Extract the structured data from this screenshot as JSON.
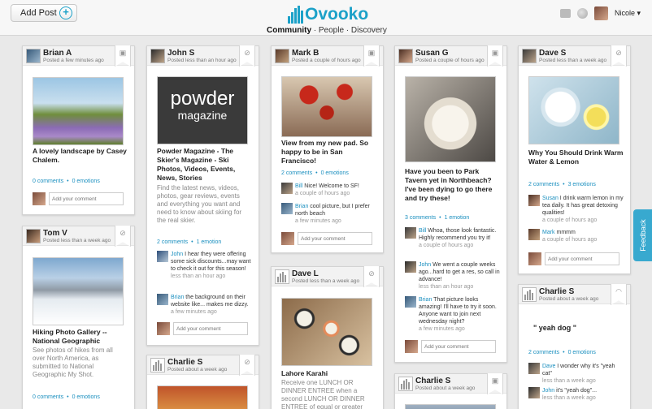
{
  "header": {
    "add_post_label": "Add Post",
    "logo_text": "Ovooko",
    "nav": {
      "active": "Community",
      "sep1": " · ",
      "people": "People",
      "sep2": " · ",
      "discovery": "Discovery"
    },
    "username": "Nicole",
    "caret": "▾"
  },
  "feedback_label": "Feedback",
  "comment_placeholder": "Add your comment",
  "posts": [
    {
      "author": "Brian A",
      "time": "Posted a few minutes ago",
      "icon": "camera-icon",
      "title": "A lovely landscape by Casey Chalem.",
      "stats": {
        "comments": "0 comments",
        "emotions": "0 emotions"
      }
    },
    {
      "author": "Tom V",
      "time": "Posted less than a week ago",
      "icon": "link-icon",
      "title": "Hiking Photo Gallery -- National Geographic",
      "desc": "See photos of hikes from all over North America, as submitted to National Geographic My Shot.",
      "stats": {
        "comments": "0 comments",
        "emotions": "0 emotions"
      }
    },
    {
      "author": "John S",
      "time": "Posted less than an hour ago",
      "icon": "link-icon",
      "image_text": {
        "line1": "powder",
        "line2": "magazine"
      },
      "title": "Powder Magazine - The Skier's Magazine - Ski Photos, Videos, Events, News, Stories",
      "desc": "Find the latest news, videos, photos, gear reviews, events and everything you want and need to know about skiing for the real skier.",
      "stats": {
        "comments": "2 comments",
        "emotions": "1 emotion"
      },
      "comments": [
        {
          "who": "John",
          "text": " I hear they were offering some sick discounts...may want to check it out for this season!",
          "when": "less than an hour ago"
        },
        {
          "who": "Brian",
          "text": " the background on their website like... makes me dizzy.",
          "when": "a few minutes ago"
        }
      ]
    },
    {
      "author": "Charlie S",
      "time": "Posted about a week ago",
      "icon": "link-icon"
    },
    {
      "author": "Mark B",
      "time": "Posted a couple of hours ago",
      "icon": "camera-icon",
      "title": "View from my new pad. So happy to be in San Francisco!",
      "stats": {
        "comments": "2 comments",
        "emotions": "0 emotions"
      },
      "comments": [
        {
          "who": "Bill",
          "text": " Nice! Welcome to SF!",
          "when": "a couple of hours ago"
        },
        {
          "who": "Brian",
          "text": " cool picture, but I prefer north beach",
          "when": "a few minutes ago"
        }
      ]
    },
    {
      "author": "Dave L",
      "time": "Posted less than a week ago",
      "icon": "link-icon",
      "title": "Lahore Karahi",
      "desc": "Receive one LUNCH OR DINNER ENTREE when a second LUNCH OR DINNER ENTREE of equal or greater"
    },
    {
      "author": "Susan G",
      "time": "Posted a couple of hours ago",
      "icon": "camera-icon",
      "title": "Have you been to Park Tavern yet in Northbeach? I've been dying to go there and try these!",
      "stats": {
        "comments": "3 comments",
        "emotions": "1 emotion"
      },
      "comments": [
        {
          "who": "Bill",
          "text": " Whoa, those look fantastic. Highly recommend you try it!",
          "when": "a couple of hours ago"
        },
        {
          "who": "John",
          "text": " We went a couple weeks ago...hard to get a res, so call in advance!",
          "when": "less than an hour ago"
        },
        {
          "who": "Brian",
          "text": " That picture looks amazing! I'll have to try it soon. Anyone want to join next wednesday night?",
          "when": "a few minutes ago"
        }
      ]
    },
    {
      "author": "Charlie S",
      "time": "Posted about a week ago",
      "icon": "camera-icon"
    },
    {
      "author": "Dave S",
      "time": "Posted less than a week ago",
      "icon": "link-icon",
      "title": "Why You Should Drink Warm Water & Lemon",
      "stats": {
        "comments": "2 comments",
        "emotions": "3 emotions"
      },
      "comments": [
        {
          "who": "Susan",
          "text": " I drink warm lemon in my tea daily. It has great detoxing qualities!",
          "when": "a couple of hours ago"
        },
        {
          "who": "Mark",
          "text": " mmmm",
          "when": "a couple of hours ago"
        }
      ]
    },
    {
      "author": "Charlie S",
      "time": "Posted about a week ago",
      "icon": "speech-icon",
      "quote": "\" yeah dog \"",
      "stats": {
        "comments": "2 comments",
        "emotions": "0 emotions"
      },
      "comments": [
        {
          "who": "Dave",
          "text": " I wonder why it's \"yeah cat\"",
          "when": "less than a week ago"
        },
        {
          "who": "John",
          "text": " it's \"yeah dog\"...",
          "when": "less than a week ago"
        }
      ]
    }
  ],
  "colors": {
    "accent": "#1ca1c8",
    "link": "#1a8fbf"
  }
}
